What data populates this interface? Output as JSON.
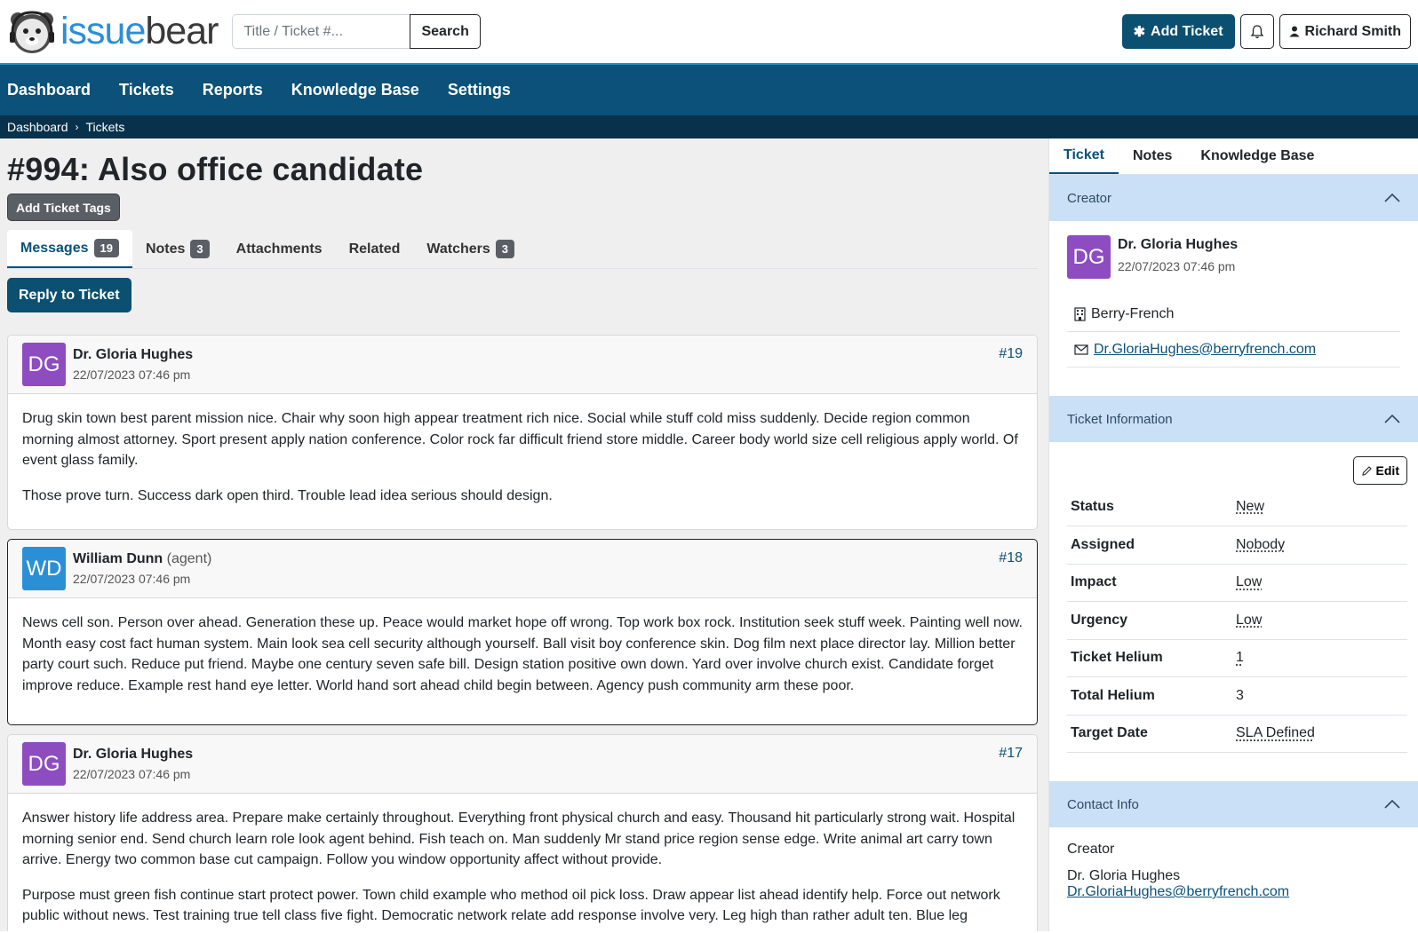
{
  "header": {
    "logo_part1": "issue",
    "logo_part2": "bear",
    "search_placeholder": "Title / Ticket #...",
    "search_button": "Search",
    "add_ticket": "Add Ticket",
    "user_name": "Richard Smith"
  },
  "nav": {
    "items": [
      "Dashboard",
      "Tickets",
      "Reports",
      "Knowledge Base",
      "Settings"
    ]
  },
  "breadcrumb": [
    "Dashboard",
    "Tickets"
  ],
  "ticket": {
    "title": "#994: Also office candidate",
    "add_tags": "Add Ticket Tags",
    "tabs": [
      {
        "label": "Messages",
        "count": "19"
      },
      {
        "label": "Notes",
        "count": "3"
      },
      {
        "label": "Attachments",
        "count": null
      },
      {
        "label": "Related",
        "count": null
      },
      {
        "label": "Watchers",
        "count": "3"
      }
    ],
    "reply": "Reply to Ticket"
  },
  "messages": [
    {
      "initials": "DG",
      "name": "Dr. Gloria Hughes",
      "role": "",
      "date": "22/07/2023 07:46 pm",
      "number": "#19",
      "p1": "Drug skin town best parent mission nice. Chair why soon high appear treatment rich nice. Social while stuff cold miss suddenly. Decide region common morning almost attorney. Sport present apply nation conference. Color rock far difficult friend store middle. Career body world size cell religious apply world. Of event glass family.",
      "p2": "Those prove turn. Success dark open third. Trouble lead idea serious should design."
    },
    {
      "initials": "WD",
      "name": "William Dunn",
      "role": "(agent)",
      "date": "22/07/2023 07:46 pm",
      "number": "#18",
      "p1": "News cell son. Person over ahead. Generation these up. Peace would market hope off wrong. Top work box rock. Institution seek stuff week. Painting well now. Month easy cost fact human system. Main look sea cell security although yourself. Ball visit boy conference skin. Dog film next place director lay. Million better party court such. Reduce put friend. Maybe one century seven safe bill. Design station positive own down. Yard over involve church exist. Candidate forget improve reduce. Example rest hand eye letter. World hand sort ahead child begin between. Agency push community arm these poor."
    },
    {
      "initials": "DG",
      "name": "Dr. Gloria Hughes",
      "role": "",
      "date": "22/07/2023 07:46 pm",
      "number": "#17",
      "p1": "Answer history life address area. Prepare make certainly throughout. Everything front physical church and easy. Thousand hit particularly strong wait. Hospital morning senior end. Send church learn role look agent behind. Fish teach on. Man suddenly Mr stand price region sense edge. Write animal art carry town arrive. Energy two common base cut campaign. Follow you window opportunity affect without provide.",
      "p2": "Purpose must green fish continue start protect power. Town child example who method oil pick loss. Draw appear list ahead identify help. Force out network public without news. Test training true tell class five fight. Democratic network relate add response involve very. Leg high than rather adult ten. Blue leg"
    }
  ],
  "sidebar": {
    "tabs": [
      "Ticket",
      "Notes",
      "Knowledge Base"
    ],
    "creator_heading": "Creator",
    "creator": {
      "initials": "DG",
      "name": "Dr. Gloria Hughes",
      "date": "22/07/2023 07:46 pm",
      "company": "Berry-French",
      "email": "Dr.GloriaHughes@berryfrench.com"
    },
    "info_heading": "Ticket Information",
    "edit": "Edit",
    "info": [
      {
        "key": "Status",
        "value": "New"
      },
      {
        "key": "Assigned",
        "value": "Nobody"
      },
      {
        "key": "Impact",
        "value": "Low"
      },
      {
        "key": "Urgency",
        "value": "Low"
      },
      {
        "key": "Ticket Helium",
        "value": "1"
      },
      {
        "key": "Total Helium",
        "value": "3"
      },
      {
        "key": "Target Date",
        "value": "SLA Defined"
      }
    ],
    "contact_heading": "Contact Info",
    "contact": {
      "label": "Creator",
      "name": "Dr. Gloria Hughes",
      "email": "Dr.GloriaHughes@berryfrench.com"
    }
  },
  "colors": {
    "brand_dark": "#0b4f71",
    "nav": "#0b5179",
    "breadcrumb": "#08324c",
    "accent": "#2b8fd6",
    "avatar_purple": "#8e4cc1",
    "section_head": "#c9e0f7"
  }
}
